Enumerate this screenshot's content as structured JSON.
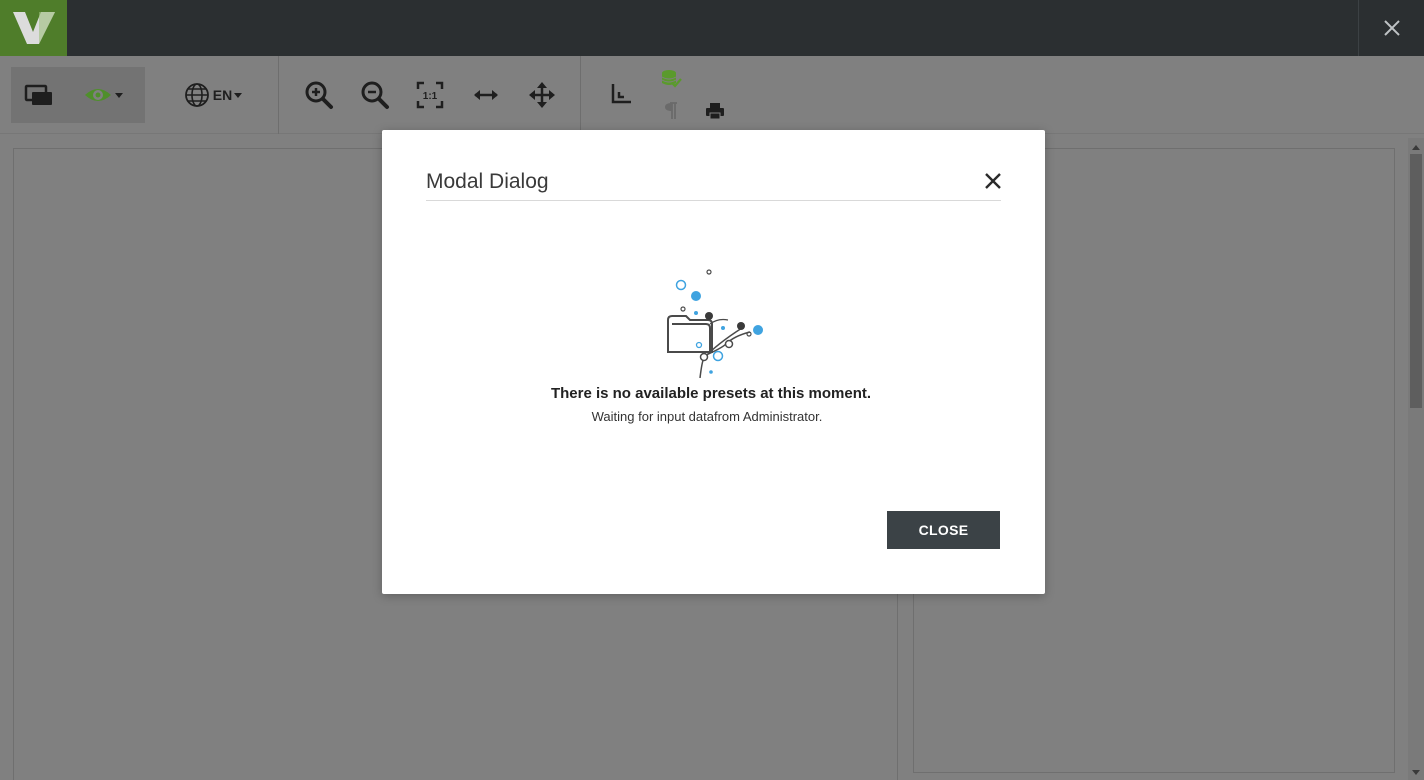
{
  "app": {
    "logo_letter": "V",
    "brand_color": "#4f7d2a",
    "topbar_color": "#2b2f31"
  },
  "toolbar": {
    "items": [
      {
        "name": "windows-icon"
      },
      {
        "name": "eye-icon",
        "color": "#4f8f2b"
      },
      {
        "name": "globe-icon"
      },
      {
        "name": "zoom-in-icon"
      },
      {
        "name": "zoom-out-icon"
      },
      {
        "name": "actual-size-icon"
      },
      {
        "name": "fit-width-icon"
      },
      {
        "name": "pan-icon"
      },
      {
        "name": "crop-corner-icon"
      },
      {
        "name": "database-check-icon",
        "color": "#5a9a2c"
      },
      {
        "name": "pilcrow-icon"
      },
      {
        "name": "print-icon"
      }
    ],
    "language": "EN"
  },
  "modal": {
    "title": "Modal Dialog",
    "message_title": "There is no available presets at this moment.",
    "message_sub": "Waiting for input datafrom Administrator.",
    "close_label": "CLOSE",
    "accent_color": "#3fa3e0"
  }
}
